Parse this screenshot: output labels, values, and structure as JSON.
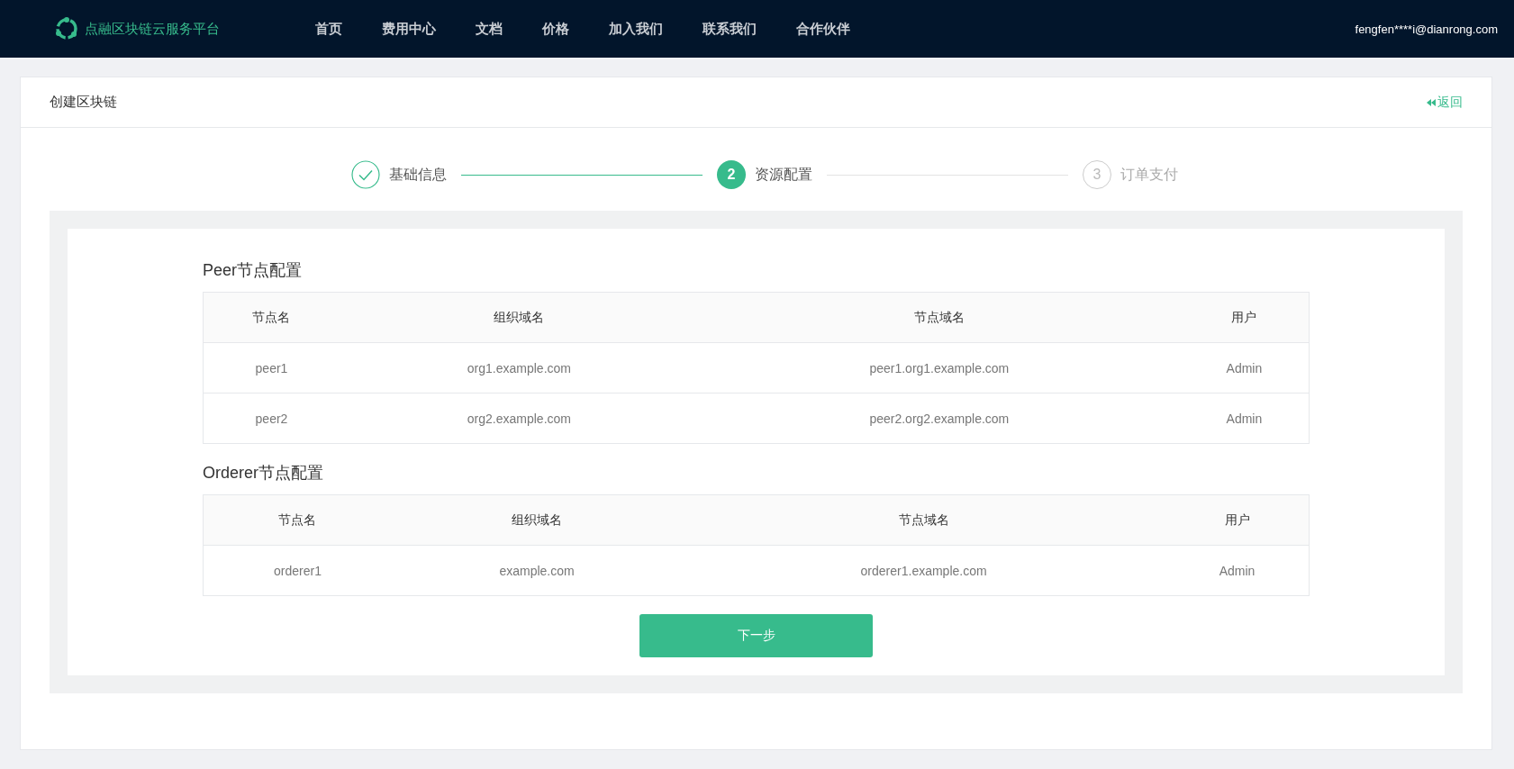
{
  "header": {
    "brand": "点融区块链云服务平台",
    "nav": [
      "首页",
      "费用中心",
      "文档",
      "价格",
      "加入我们",
      "联系我们",
      "合作伙伴"
    ],
    "user": "fengfen****i@dianrong.com"
  },
  "page": {
    "title": "创建区块链",
    "back": "返回"
  },
  "steps": [
    {
      "label": "基础信息",
      "completed": true,
      "selected": false
    },
    {
      "number": "2",
      "label": "资源配置",
      "completed": false,
      "selected": true
    },
    {
      "number": "3",
      "label": "订单支付",
      "completed": false,
      "selected": false
    }
  ],
  "sections": [
    {
      "title": "Peer节点配置",
      "columns": [
        "节点名",
        "组织域名",
        "节点域名",
        "用户"
      ],
      "rows": [
        [
          "peer1",
          "org1.example.com",
          "peer1.org1.example.com",
          "Admin"
        ],
        [
          "peer2",
          "org2.example.com",
          "peer2.org2.example.com",
          "Admin"
        ]
      ]
    },
    {
      "title": "Orderer节点配置",
      "columns": [
        "节点名",
        "组织域名",
        "节点域名",
        "用户"
      ],
      "rows": [
        [
          "orderer1",
          "example.com",
          "orderer1.example.com",
          "Admin"
        ]
      ]
    }
  ],
  "next_button": "下一步"
}
